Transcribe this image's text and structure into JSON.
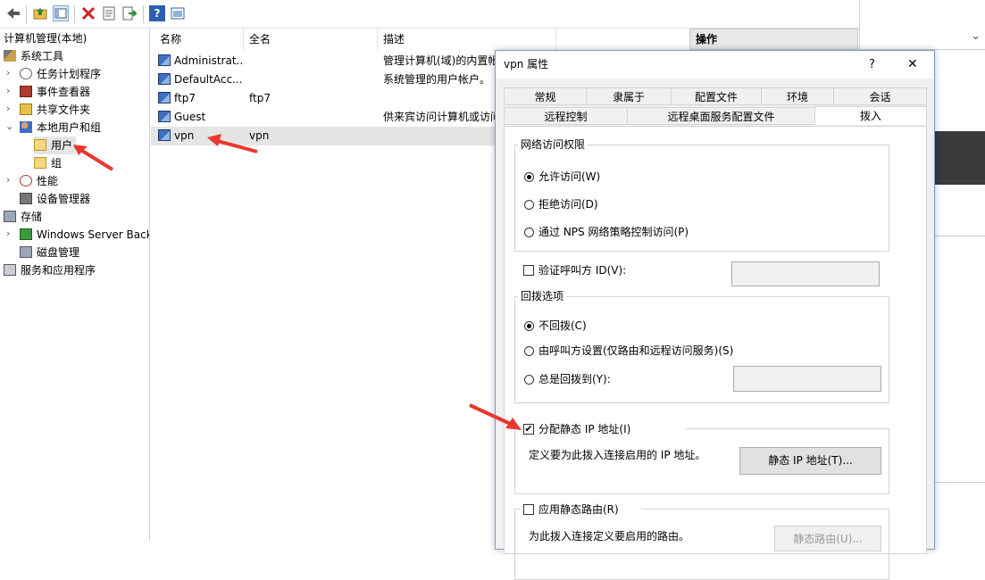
{
  "toolbar": {
    "icons": [
      "back-icon",
      "up-folder-icon",
      "show-hide-tree-icon",
      "delete-icon",
      "properties-icon",
      "export-icon",
      "help-icon",
      "view-icon"
    ]
  },
  "tree": {
    "root": "计算机管理(本地)",
    "system_tools": "系统工具",
    "task_scheduler": "任务计划程序",
    "event_viewer": "事件查看器",
    "shared_folders": "共享文件夹",
    "local_users_groups": "本地用户和组",
    "users": "用户",
    "groups": "组",
    "performance": "性能",
    "device_manager": "设备管理器",
    "storage": "存储",
    "windows_server_backup": "Windows Server Back",
    "disk_management": "磁盘管理",
    "services_apps": "服务和应用程序"
  },
  "list": {
    "columns": [
      "名称",
      "全名",
      "描述"
    ],
    "rows": [
      {
        "name": "Administrat...",
        "fullname": "",
        "desc": "管理计算机(域)的内置帐"
      },
      {
        "name": "DefaultAcc...",
        "fullname": "",
        "desc": "系统管理的用户帐户。"
      },
      {
        "name": "ftp7",
        "fullname": "ftp7",
        "desc": ""
      },
      {
        "name": "Guest",
        "fullname": "",
        "desc": "供来宾访问计算机或访问"
      },
      {
        "name": "vpn",
        "fullname": "vpn",
        "desc": ""
      }
    ]
  },
  "actions": {
    "header": "操作"
  },
  "dialog": {
    "title": "vpn 属性",
    "help": "?",
    "close": "✕",
    "tabs_row1": [
      "常规",
      "隶属于",
      "配置文件",
      "环境",
      "会话"
    ],
    "tabs_row2": [
      "远程控制",
      "远程桌面服务配置文件",
      "拨入"
    ],
    "network_access": {
      "title": "网络访问权限",
      "allow": "允许访问(W)",
      "deny": "拒绝访问(D)",
      "nps": "通过 NPS 网络策略控制访问(P)",
      "selected": "allow"
    },
    "verify_caller": {
      "label": "验证呼叫方 ID(V):",
      "checked": false,
      "value": ""
    },
    "callback": {
      "title": "回拨选项",
      "no_callback": "不回拨(C)",
      "set_by_caller": "由呼叫方设置(仅路由和远程访问服务)(S)",
      "always": "总是回拨到(Y):",
      "selected": "no_callback",
      "always_value": ""
    },
    "static_ip": {
      "label": "分配静态 IP 地址(I)",
      "checked": true,
      "desc": "定义要为此拨入连接启用的 IP 地址。",
      "button": "静态 IP 地址(T)..."
    },
    "static_routes": {
      "label": "应用静态路由(R)",
      "checked": false,
      "desc": "为此拨入连接定义要启用的路由。",
      "button": "静态路由(U)..."
    }
  },
  "colors": {
    "arrow": "#e8382f",
    "selection": "#e5e5e5",
    "accent": "#0078d7"
  }
}
